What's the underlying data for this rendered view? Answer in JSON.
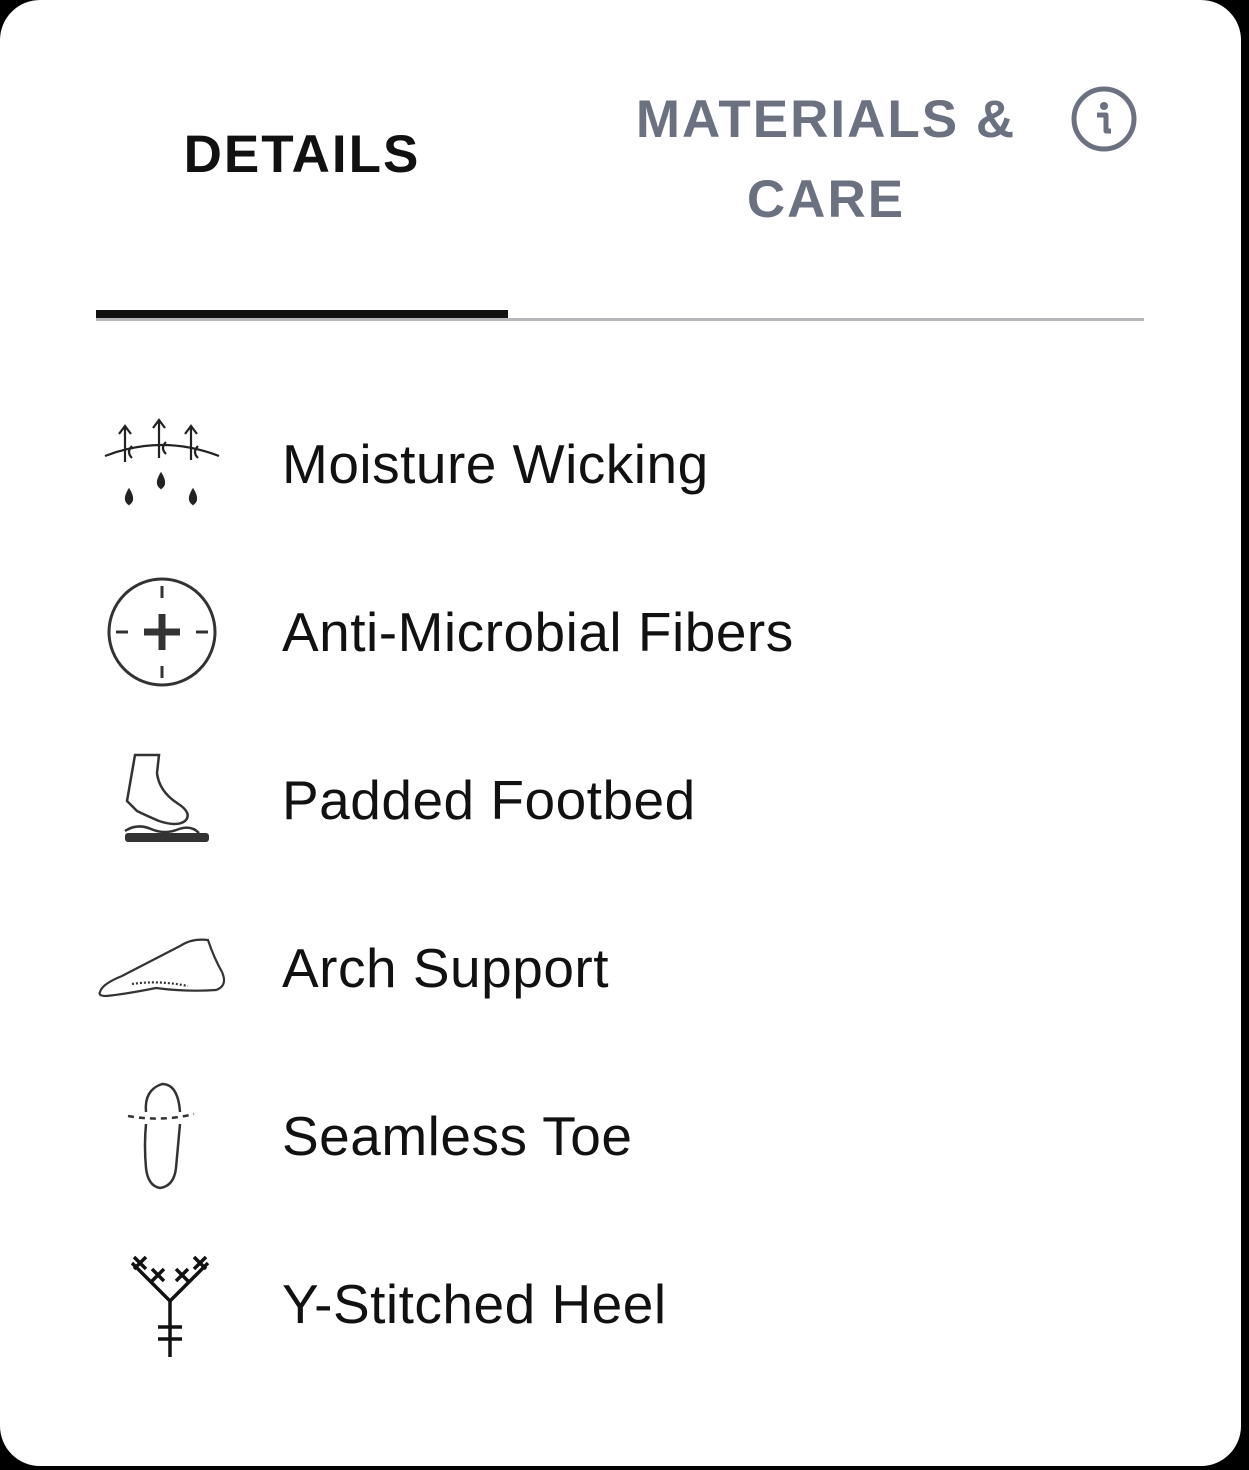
{
  "tabs": {
    "details_label": "DETAILS",
    "materials_label": "MATERIALS & CARE",
    "active": "details"
  },
  "info_icon": "info-circle-icon",
  "features": [
    {
      "label": "Moisture Wicking",
      "icon": "moisture-wicking-icon"
    },
    {
      "label": "Anti-Microbial Fibers",
      "icon": "anti-microbial-icon"
    },
    {
      "label": "Padded Footbed",
      "icon": "padded-footbed-icon"
    },
    {
      "label": "Arch Support",
      "icon": "arch-support-icon"
    },
    {
      "label": "Seamless Toe",
      "icon": "seamless-toe-icon"
    },
    {
      "label": "Y-Stitched Heel",
      "icon": "y-stitched-heel-icon"
    }
  ],
  "colors": {
    "active_tab": "#111111",
    "inactive_tab": "#6b7180",
    "divider": "#b5b7bb",
    "background": "#ffffff"
  }
}
